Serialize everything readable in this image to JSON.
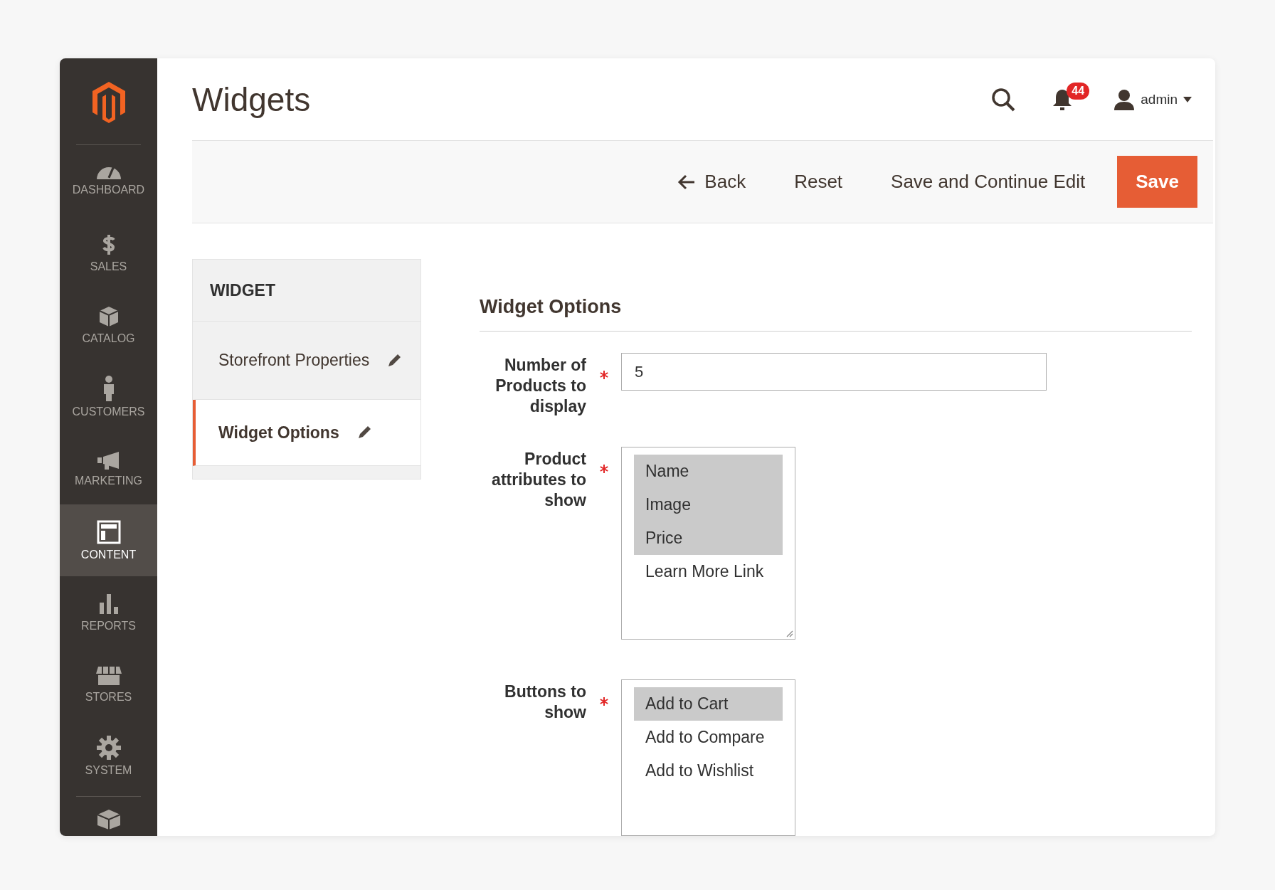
{
  "sidebar": {
    "items": [
      {
        "label": "DASHBOARD",
        "selected": false
      },
      {
        "label": "SALES",
        "selected": false
      },
      {
        "label": "CATALOG",
        "selected": false
      },
      {
        "label": "CUSTOMERS",
        "selected": false
      },
      {
        "label": "MARKETING",
        "selected": false
      },
      {
        "label": "CONTENT",
        "selected": true
      },
      {
        "label": "REPORTS",
        "selected": false
      },
      {
        "label": "STORES",
        "selected": false
      },
      {
        "label": "SYSTEM",
        "selected": false
      }
    ]
  },
  "header": {
    "title": "Widgets",
    "notification_count": "44",
    "user": "admin"
  },
  "actions": [
    {
      "label": "Back",
      "kind": "back"
    },
    {
      "label": "Reset",
      "kind": "plain"
    },
    {
      "label": "Save and Continue Edit",
      "kind": "plain"
    },
    {
      "label": "Save",
      "kind": "primary"
    }
  ],
  "nav": {
    "heading": "WIDGET",
    "items": [
      {
        "label": "Storefront Properties",
        "selected": false
      },
      {
        "label": "Widget Options",
        "selected": true
      }
    ]
  },
  "form": {
    "title": "Widget Options",
    "fields": [
      {
        "kind": "text",
        "label": "Number of Products to display",
        "required": true,
        "value": "5"
      },
      {
        "kind": "multiselect",
        "label": "Product attributes to show",
        "required": true,
        "options": [
          {
            "label": "Name",
            "selected": true
          },
          {
            "label": "Image",
            "selected": true
          },
          {
            "label": "Price",
            "selected": true
          },
          {
            "label": "Learn More Link",
            "selected": false
          }
        ]
      },
      {
        "kind": "multiselect",
        "label": "Buttons to show",
        "required": true,
        "options": [
          {
            "label": "Add to Cart",
            "selected": true
          },
          {
            "label": "Add to Compare",
            "selected": false
          },
          {
            "label": "Add to Wishlist",
            "selected": false
          }
        ]
      }
    ]
  }
}
